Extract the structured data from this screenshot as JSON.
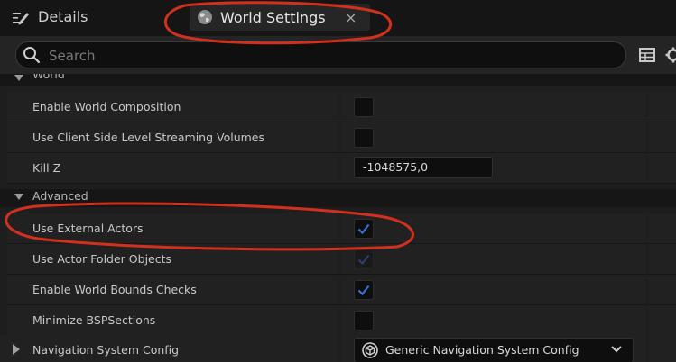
{
  "tabs": {
    "details_label": "Details",
    "world_settings_label": "World Settings",
    "close_glyph": "×"
  },
  "search": {
    "placeholder": "Search"
  },
  "toolbar_icons": [
    "table-view-icon",
    "settings-gear-icon"
  ],
  "sections": {
    "world": "World",
    "advanced": "Advanced"
  },
  "properties": {
    "enable_world_composition": {
      "label": "Enable World Composition",
      "checked": false
    },
    "use_client_side_level_streaming_volumes": {
      "label": "Use Client Side Level Streaming Volumes",
      "checked": false
    },
    "kill_z": {
      "label": "Kill Z",
      "value": "-1048575,0"
    },
    "use_external_actors": {
      "label": "Use External Actors",
      "checked": true
    },
    "use_actor_folder_objects": {
      "label": "Use Actor Folder Objects",
      "checked": true,
      "disabled": true
    },
    "enable_world_bounds_checks": {
      "label": "Enable World Bounds Checks",
      "checked": true
    },
    "minimize_bsp_sections": {
      "label": "Minimize BSPSections",
      "checked": false
    },
    "navigation_system_config": {
      "label": "Navigation System Config",
      "value": "Generic Navigation System Config"
    }
  },
  "colors": {
    "check_accent": "#3a6fd8",
    "check_disabled": "#2c3f66",
    "annotation_red": "#d2301e"
  }
}
